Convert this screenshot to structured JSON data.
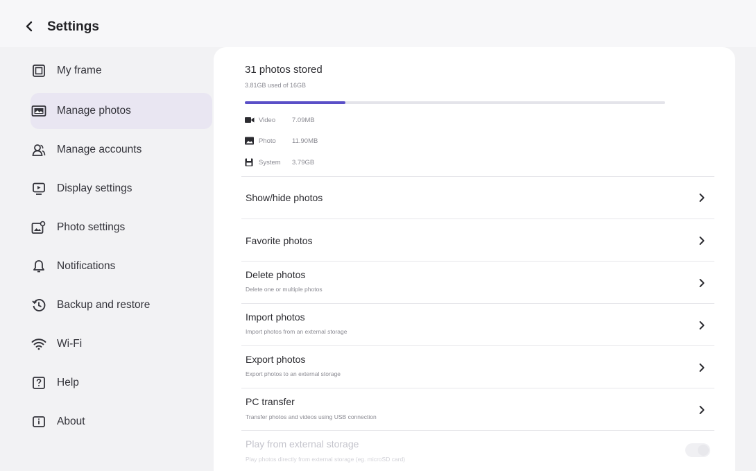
{
  "header": {
    "title": "Settings",
    "back_icon": "back-chevron-icon"
  },
  "sidebar": {
    "items": [
      {
        "label": "My frame",
        "icon": "frame-icon",
        "active": false
      },
      {
        "label": "Manage photos",
        "icon": "photos-icon",
        "active": true
      },
      {
        "label": "Manage accounts",
        "icon": "accounts-icon",
        "active": false
      },
      {
        "label": "Display settings",
        "icon": "display-icon",
        "active": false
      },
      {
        "label": "Photo settings",
        "icon": "photo-settings-icon",
        "active": false
      },
      {
        "label": "Notifications",
        "icon": "bell-icon",
        "active": false
      },
      {
        "label": "Backup and restore",
        "icon": "backup-icon",
        "active": false
      },
      {
        "label": "Wi-Fi",
        "icon": "wifi-icon",
        "active": false
      },
      {
        "label": "Help",
        "icon": "help-icon",
        "active": false
      },
      {
        "label": "About",
        "icon": "about-icon",
        "active": false
      }
    ]
  },
  "storage": {
    "title": "31 photos stored",
    "subtitle": "3.81GB used of 16GB",
    "used_fraction": 0.24,
    "accent_color": "#5a4fc7",
    "breakdown": [
      {
        "name": "Video",
        "value": "7.09MB",
        "icon": "video-icon"
      },
      {
        "name": "Photo",
        "value": "11.90MB",
        "icon": "image-icon"
      },
      {
        "name": "System",
        "value": "3.79GB",
        "icon": "system-icon"
      }
    ]
  },
  "menu": [
    {
      "title": "Show/hide photos",
      "desc": ""
    },
    {
      "title": "Favorite photos",
      "desc": ""
    },
    {
      "title": "Delete photos",
      "desc": "Delete one or multiple photos"
    },
    {
      "title": "Import photos",
      "desc": "Import photos from an external storage"
    },
    {
      "title": "Export photos",
      "desc": "Export photos to an external storage"
    },
    {
      "title": "PC transfer",
      "desc": "Transfer photos and videos using USB connection"
    },
    {
      "title": "Play from external storage",
      "desc": "Play photos directly from external storage (eg. microSD card)",
      "disabled": true
    }
  ]
}
